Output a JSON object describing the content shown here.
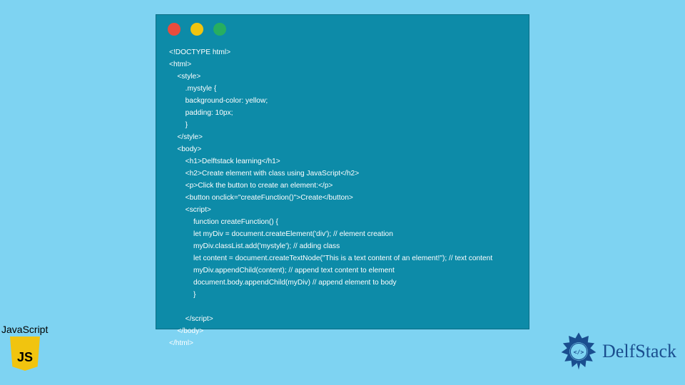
{
  "code_window": {
    "lines": [
      "<!DOCTYPE html>",
      "<html>",
      "    <style>",
      "        .mystyle {",
      "        background-color: yellow;",
      "        padding: 10px;",
      "        }",
      "    </style>",
      "    <body>",
      "        <h1>Delftstack learning</h1>",
      "        <h2>Create element with class using JavaScript</h2>",
      "        <p>Click the button to create an element:</p>",
      "        <button onclick=\"createFunction()\">Create</button>",
      "        <script>",
      "            function createFunction() {",
      "            let myDiv = document.createElement('div'); // element creation",
      "            myDiv.classList.add('mystyle'); // adding class",
      "            let content = document.createTextNode(\"This is a text content of an element!\"); // text content",
      "            myDiv.appendChild(content); // append text content to element",
      "            document.body.appendChild(myDiv) // append element to body",
      "            }",
      "",
      "        </script>",
      "    </body>",
      "</html>"
    ]
  },
  "js_badge": {
    "label": "JavaScript",
    "logo_text": "JS"
  },
  "brand": {
    "name": "DelfStack"
  },
  "colors": {
    "page_bg": "#7ed3f2",
    "window_bg": "#0d8ba8",
    "dot_red": "#e84c3d",
    "dot_yellow": "#f1c40f",
    "dot_green": "#27ae60",
    "brand_blue": "#1a4e8f"
  }
}
